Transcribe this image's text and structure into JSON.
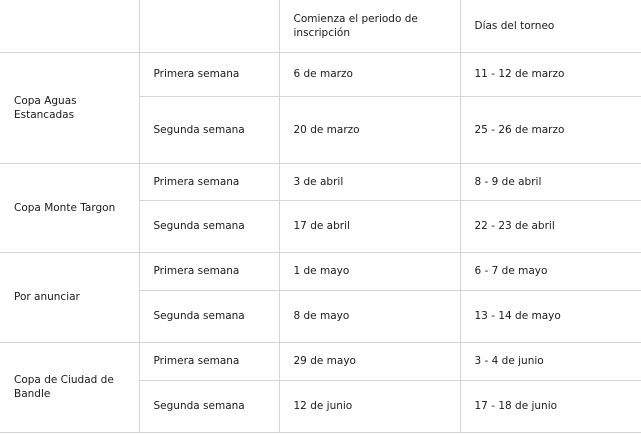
{
  "header": {
    "col1": "",
    "col2": "",
    "col3": "Comienza el periodo de inscripción",
    "col4": "Días del torneo"
  },
  "cups": [
    {
      "name": "Copa Aguas Estancadas",
      "weeks": [
        {
          "label": "Primera semana",
          "registration": "6 de marzo",
          "days": "11 - 12 de marzo"
        },
        {
          "label": "Segunda semana",
          "registration": "20 de marzo",
          "days": "25 - 26 de marzo"
        }
      ]
    },
    {
      "name": "Copa Monte Targon",
      "weeks": [
        {
          "label": "Primera semana",
          "registration": "3 de abril",
          "days": "8 - 9 de abril"
        },
        {
          "label": "Segunda semana",
          "registration": "17 de abril",
          "days": "22 - 23 de abril"
        }
      ]
    },
    {
      "name": "Por anunciar",
      "weeks": [
        {
          "label": "Primera semana",
          "registration": "1 de mayo",
          "days": "6 - 7 de mayo"
        },
        {
          "label": "Segunda semana",
          "registration": "8 de mayo",
          "days": "13 - 14 de mayo"
        }
      ]
    },
    {
      "name": "Copa de Ciudad de Bandle",
      "weeks": [
        {
          "label": "Primera semana",
          "registration": "29 de mayo",
          "days": "3 - 4 de junio"
        },
        {
          "label": "Segunda semana",
          "registration": "12 de junio",
          "days": "17 - 18 de junio"
        }
      ]
    }
  ]
}
